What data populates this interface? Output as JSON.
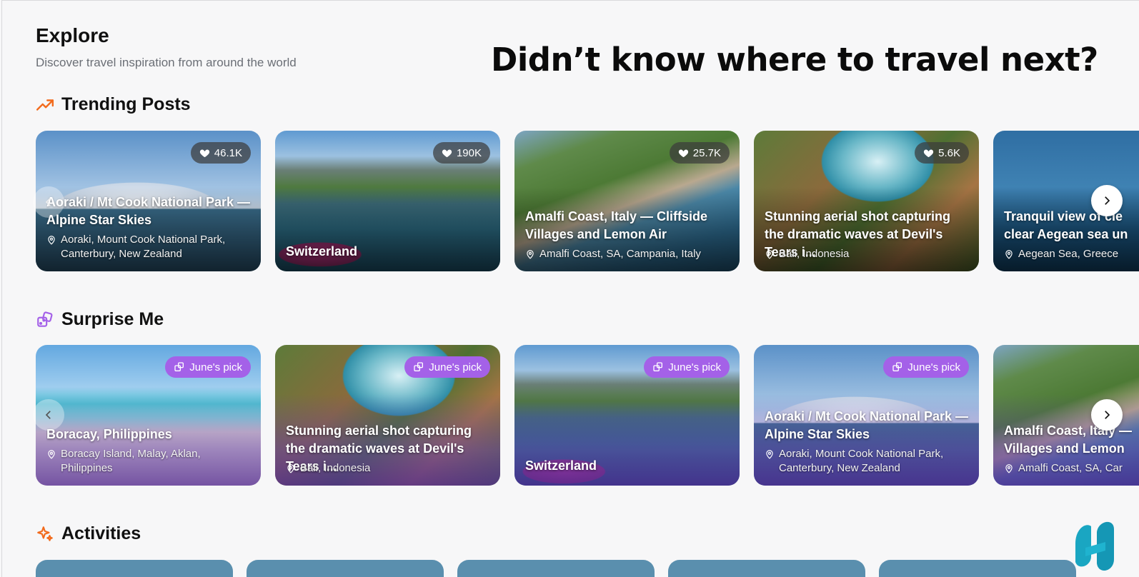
{
  "page": {
    "title": "Explore",
    "subtitle": "Discover travel inspiration from around the world",
    "headline": "Didn’t know where to travel next?"
  },
  "colors": {
    "accent_orange": "#f26b1d",
    "accent_purple": "#a461e8",
    "background": "#f7f7f8"
  },
  "sections": {
    "trending": {
      "title": "Trending Posts",
      "icon": "trending-up-icon"
    },
    "surprise": {
      "title": "Surprise Me",
      "icon": "dice-icon"
    },
    "activities": {
      "title": "Activities",
      "icon": "sparkles-icon"
    }
  },
  "trending_posts": [
    {
      "title": "Aoraki / Mt Cook National Park — Alpine Star Skies",
      "location": "Aoraki, Mount Cook National Park, Canterbury, New Zealand",
      "likes": "46.1K"
    },
    {
      "title": "Switzerland",
      "location": "",
      "likes": "190K"
    },
    {
      "title": "Amalfi Coast, Italy — Cliffside Villages and Lemon Air",
      "location": "Amalfi Coast, SA, Campania, Italy",
      "likes": "25.7K"
    },
    {
      "title": "Stunning aerial shot capturing the dramatic waves at Devil's Tears i...",
      "location": "Bali, Indonesia",
      "likes": "5.6K"
    },
    {
      "title": "Tranquil view of cle clear Aegean sea un",
      "location": "Aegean Sea, Greece",
      "likes": ""
    }
  ],
  "surprise_posts": [
    {
      "title": "Boracay, Philippines",
      "location": "Boracay Island, Malay, Aklan, Philippines",
      "badge": "June's pick"
    },
    {
      "title": "Stunning aerial shot capturing the dramatic waves at Devil's Tears i...",
      "location": "Bali, Indonesia",
      "badge": "June's pick"
    },
    {
      "title": "Switzerland",
      "location": "",
      "badge": "June's pick"
    },
    {
      "title": "Aoraki / Mt Cook National Park — Alpine Star Skies",
      "location": "Aoraki, Mount Cook National Park, Canterbury, New Zealand",
      "badge": "June's pick"
    },
    {
      "title": "Amalfi Coast, Italy — Villages and Lemon",
      "location": "Amalfi Coast, SA, Car",
      "badge": ""
    }
  ],
  "icons": {
    "like": "heart-icon",
    "location": "map-pin-icon",
    "pick": "dice-icon",
    "prev": "chevron-left-icon",
    "next": "chevron-right-icon"
  }
}
